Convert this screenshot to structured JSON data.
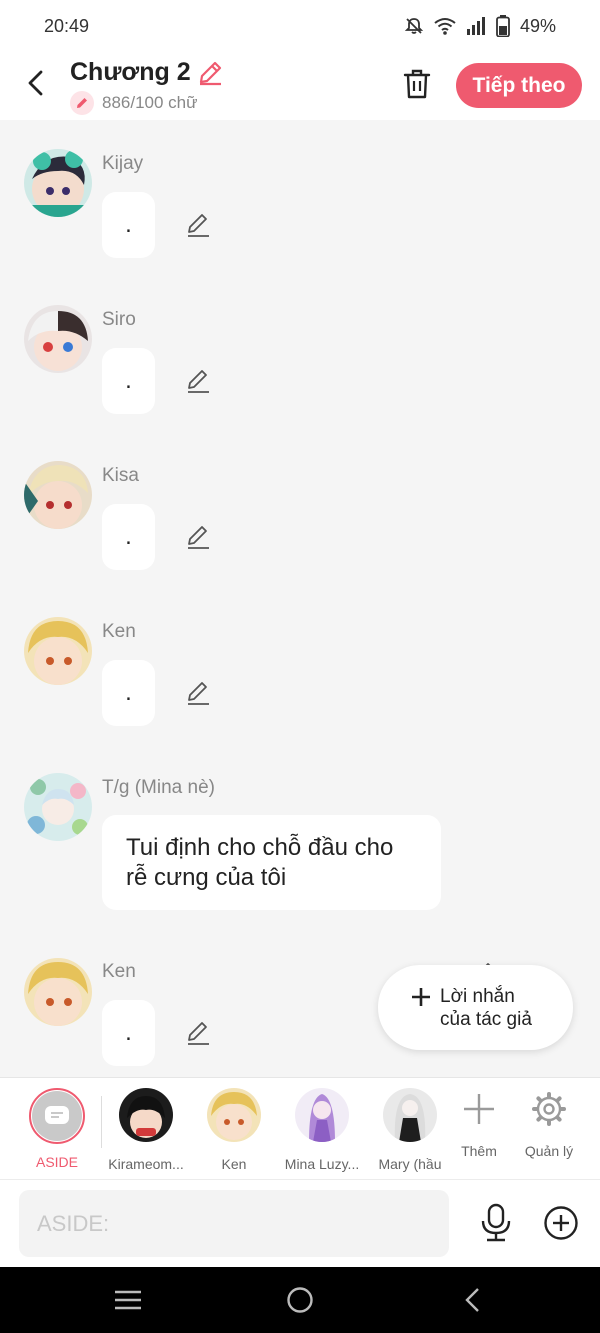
{
  "status": {
    "time": "20:49",
    "battery": "49%"
  },
  "header": {
    "title": "Chương 2",
    "word_count": "886/100 chữ",
    "next_label": "Tiếp theo"
  },
  "messages": [
    {
      "sender": "Kijay",
      "text": "."
    },
    {
      "sender": "Siro",
      "text": "."
    },
    {
      "sender": "Kisa",
      "text": "."
    },
    {
      "sender": "Ken",
      "text": "."
    },
    {
      "sender": "T/g (Mina nè)",
      "text": "Tui định cho chỗ đầu cho rễ cưng của tôi"
    },
    {
      "sender": "Ken",
      "text": "."
    }
  ],
  "fab": {
    "label": "Lời nhắn của tác giả"
  },
  "characters": [
    {
      "label": "ASIDE"
    },
    {
      "label": "Kirameom..."
    },
    {
      "label": "Ken"
    },
    {
      "label": "Mina Luzy..."
    },
    {
      "label": "Mary (hầu"
    },
    {
      "label": "Thêm"
    },
    {
      "label": "Quản lý"
    }
  ],
  "input": {
    "placeholder": "ASIDE:"
  },
  "colors": {
    "accent": "#ef5a6f",
    "background": "#f5f5f5"
  }
}
